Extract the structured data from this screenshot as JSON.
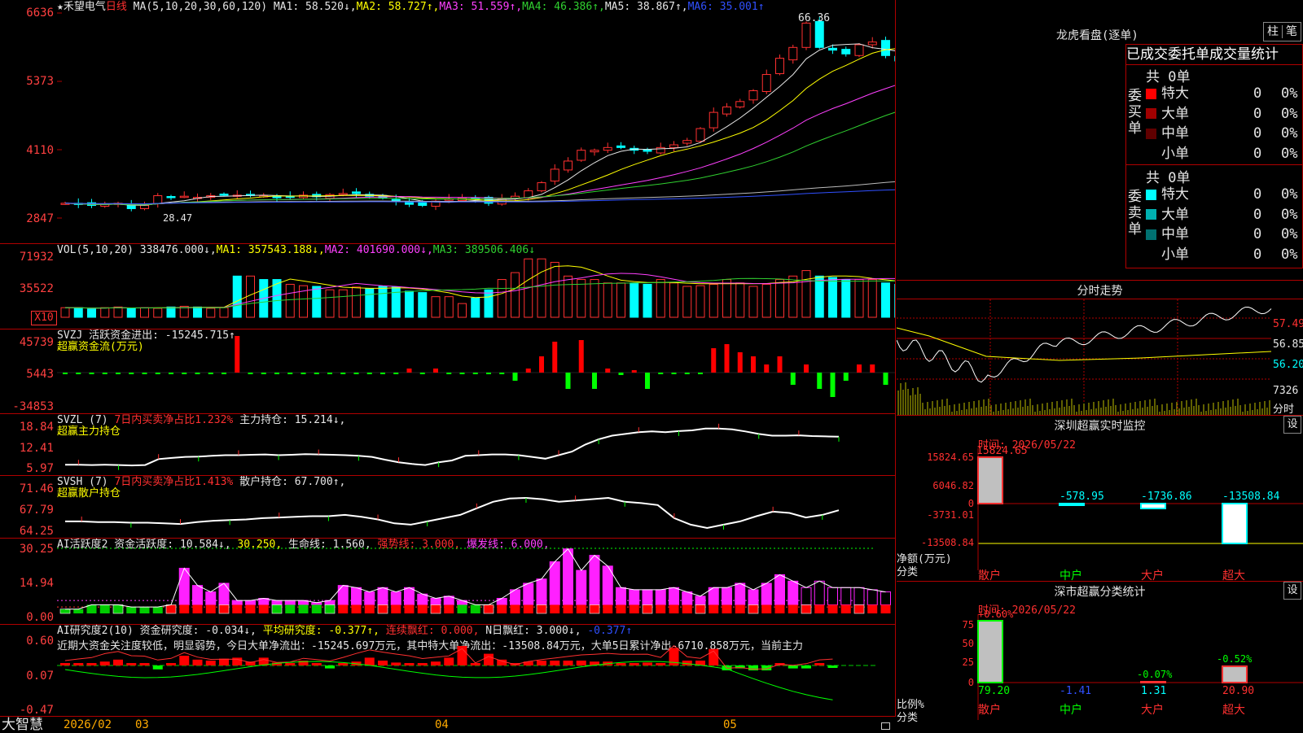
{
  "stock": {
    "name": "★禾望电气",
    "period": "日线",
    "ma_line": [
      {
        "t": "MA(5,10,20,30,60,120) ",
        "c": "w"
      },
      {
        "t": "MA1: 58.520↓,",
        "c": "w"
      },
      {
        "t": "MA2: 58.727↑,",
        "c": "y"
      },
      {
        "t": "MA3: 51.559↑,",
        "c": "m"
      },
      {
        "t": "MA4: 46.386↑,",
        "c": "g"
      },
      {
        "t": "MA5: 38.867↑,",
        "c": "w"
      },
      {
        "t": "MA6: 35.001↑",
        "c": "b"
      }
    ]
  },
  "bottom_bar": {
    "brand": "大智慧",
    "dates": [
      "2026/02",
      "03",
      "04",
      "05"
    ]
  },
  "panels": {
    "price": {
      "y_labels": [
        "6636",
        "5373",
        "4110",
        "2847"
      ],
      "high_label": "66.36",
      "low_label": "28.47"
    },
    "vol": {
      "y_labels": [
        "71932",
        "35522",
        "X10"
      ],
      "header": [
        {
          "t": "VOL(5,10,20) ",
          "c": "w"
        },
        {
          "t": "338476.000↓,",
          "c": "w"
        },
        {
          "t": "MA1: 357543.188↓,",
          "c": "y"
        },
        {
          "t": "MA2: 401690.000↓,",
          "c": "m"
        },
        {
          "t": "MA3: 389506.406↓",
          "c": "g"
        }
      ]
    },
    "svzj": {
      "y_labels": [
        "45739",
        "5443",
        "-34853"
      ],
      "header": [
        {
          "t": "SVZJ  活跃资金进出: -15245.715↑,",
          "c": "w"
        }
      ],
      "subtitle": "超赢资金流(万元)"
    },
    "svzl": {
      "y_labels": [
        "18.84",
        "12.41",
        "5.97"
      ],
      "header": [
        {
          "t": "SVZL (7) ",
          "c": "w"
        },
        {
          "t": "7日内买卖净占比1.232% ",
          "c": "r"
        },
        {
          "t": "主力持仓: 15.214↓,",
          "c": "w"
        }
      ],
      "subtitle": "超赢主力持仓"
    },
    "svsh": {
      "y_labels": [
        "71.46",
        "67.79",
        "64.25"
      ],
      "header": [
        {
          "t": "SVSH (7) ",
          "c": "w"
        },
        {
          "t": "7日内买卖净占比1.413% ",
          "c": "r"
        },
        {
          "t": "散户持仓: 67.700↑,",
          "c": "w"
        }
      ],
      "subtitle": "超赢散户持仓"
    },
    "ai1": {
      "y_labels": [
        "30.25",
        "14.94",
        "0.00"
      ],
      "header": [
        {
          "t": "AI活跃度2 资金活跃度: 10.584↓, ",
          "c": "w"
        },
        {
          "t": "30.250, ",
          "c": "y"
        },
        {
          "t": "生命线: 1.560, ",
          "c": "w"
        },
        {
          "t": "强势线: 3.000, ",
          "c": "r"
        },
        {
          "t": "爆发线: 6.000,",
          "c": "m"
        }
      ]
    },
    "ai2": {
      "y_labels": [
        "0.60",
        "0.07",
        "-0.47"
      ],
      "header": [
        {
          "t": "AI研究度2(10) 资金研究度: -0.034↓, ",
          "c": "w"
        },
        {
          "t": "平均研究度: -0.377↑, ",
          "c": "y"
        },
        {
          "t": "连续飘红: 0.000, ",
          "c": "r"
        },
        {
          "t": "N日飘红: 3.000↓, ",
          "c": "w"
        },
        {
          "t": "-0.377↑",
          "c": "b"
        }
      ],
      "text": "近期大资金关注度较低，明显弱势，今日大单净流出：-15245.697万元，其中特大单净流出：-13508.84万元，大单5日累计净出-6710.858万元，当前主力"
    }
  },
  "right": {
    "lhb": {
      "title": "龙虎看盘(逐单)",
      "buttons": [
        "柱",
        "笔"
      ],
      "tabs": [
        "已成交委托",
        "单成交量统计"
      ],
      "buy": {
        "label": "委买单",
        "total": "共 0单",
        "rows": [
          {
            "name": "特大",
            "val": "0",
            "pct": "0%",
            "color": "#ff0000"
          },
          {
            "name": "大单",
            "val": "0",
            "pct": "0%",
            "color": "#a00000"
          },
          {
            "name": "中单",
            "val": "0",
            "pct": "0%",
            "color": "#600000"
          },
          {
            "name": "小单",
            "val": "0",
            "pct": "0%",
            "color": "#000000"
          }
        ]
      },
      "sell": {
        "label": "委卖单",
        "total": "共 0单",
        "rows": [
          {
            "name": "特大",
            "val": "0",
            "pct": "0%",
            "color": "#00ffff"
          },
          {
            "name": "大单",
            "val": "0",
            "pct": "0%",
            "color": "#00b0b0"
          },
          {
            "name": "中单",
            "val": "0",
            "pct": "0%",
            "color": "#007070"
          },
          {
            "name": "小单",
            "val": "0",
            "pct": "0%",
            "color": "#000000"
          }
        ]
      }
    },
    "intraday": {
      "title": "分时走势",
      "labels": [
        "57.49",
        "56.85",
        "56.20",
        "7326",
        "分时"
      ]
    },
    "monitor": {
      "title": "深圳超赢实时监控",
      "set": "设",
      "time": "时间: 2026/05/22",
      "y_labels": [
        "15824.65",
        "6046.82",
        "0",
        "-3731.01",
        "-13508.84"
      ],
      "unit_label": "净额(万元)",
      "cat_label": "分类",
      "categories": [
        "散户",
        "中户",
        "大户",
        "超大"
      ],
      "values": [
        "15824.65",
        "-578.95",
        "-1736.86",
        "-13508.84"
      ]
    },
    "stats": {
      "title": "深市超赢分类统计",
      "set": "设",
      "time": "时间: 2026/05/22",
      "y_labels": [
        "75",
        "50",
        "25",
        "0"
      ],
      "unit_label": "比例%",
      "cat_label": "分类",
      "categories": [
        "散户",
        "中户",
        "大户",
        "超大"
      ],
      "values": [
        "79.20",
        "-1.41",
        "1.31",
        "20.90"
      ],
      "pct_labels": [
        "+0.60%",
        "-0.07%",
        "-0.52%"
      ]
    }
  },
  "chart_data": [
    {
      "type": "candlestick",
      "title": "禾望电气 日线",
      "ylim": [
        28.47,
        66.36
      ],
      "y_ticks": [
        66.36,
        53.73,
        41.1,
        28.47
      ],
      "x_months": [
        "2026/02",
        "03",
        "04",
        "05"
      ],
      "close": [
        31.2,
        31.0,
        30.8,
        31.0,
        31.2,
        30.2,
        30.8,
        32.6,
        32.3,
        32.5,
        32.3,
        32.6,
        32.8,
        32.7,
        32.8,
        32.6,
        32.2,
        32.4,
        32.7,
        32.4,
        32.8,
        33.0,
        33.0,
        32.5,
        32.2,
        31.5,
        31.0,
        30.8,
        31.6,
        32.0,
        32.2,
        32.0,
        31.2,
        32.0,
        32.5,
        33.5,
        35.0,
        37.5,
        39.0,
        41.0,
        41.0,
        41.5,
        41.5,
        41.0,
        40.8,
        41.5,
        42.0,
        42.8,
        45.0,
        48.0,
        49.0,
        50.0,
        52.0,
        55.0,
        58.0,
        60.0,
        64.5,
        60.0,
        59.5,
        58.8,
        60.5,
        61.0,
        58.5,
        57.5
      ],
      "ma_series": [
        "MA1",
        "MA2",
        "MA3",
        "MA4",
        "MA5",
        "MA6"
      ]
    },
    {
      "type": "bar",
      "title": "VOL(5,10,20)",
      "ylim": [
        0,
        719320
      ],
      "y_ticks": [
        719320,
        355220
      ],
      "unit": "X10",
      "values": [
        14,
        14,
        12,
        14,
        15,
        13,
        14,
        13,
        15,
        16,
        15,
        13,
        14,
        60,
        60,
        55,
        55,
        48,
        46,
        45,
        40,
        40,
        44,
        42,
        45,
        44,
        38,
        36,
        30,
        30,
        20,
        28,
        40,
        55,
        65,
        85,
        85,
        80,
        60,
        55,
        55,
        50,
        50,
        50,
        48,
        55,
        50,
        45,
        46,
        48,
        55,
        50,
        45,
        48,
        55,
        60,
        68,
        60,
        58,
        55,
        55,
        55,
        50,
        48
      ]
    },
    {
      "type": "bar",
      "title": "SVZJ 活跃资金进出 (万元)",
      "ylim": [
        -34853,
        45739
      ],
      "y_ticks": [
        45739,
        5443,
        -34853
      ],
      "values": [
        0,
        0,
        0,
        0,
        0,
        -1,
        -1,
        -1,
        -1,
        -1,
        0,
        0,
        0,
        45,
        0,
        0,
        0,
        0,
        0,
        0,
        0,
        0,
        0,
        0,
        0,
        0,
        5,
        0,
        5,
        0,
        0,
        0,
        0,
        0,
        -10,
        5,
        20,
        38,
        -20,
        40,
        -20,
        5,
        -3,
        3,
        -20,
        0,
        0,
        0,
        0,
        30,
        35,
        25,
        20,
        10,
        20,
        -15,
        10,
        -20,
        -30,
        -10,
        10,
        10,
        -15,
        -15
      ],
      "latest": -15245.715
    },
    {
      "type": "line",
      "title": "SVZL 主力持仓",
      "ylim": [
        5.97,
        18.84
      ],
      "y_ticks": [
        18.84,
        12.41,
        5.97
      ],
      "values": [
        7.3,
        7.3,
        7.2,
        7.3,
        7.2,
        7.1,
        7.2,
        8.9,
        9.2,
        9.5,
        9.6,
        9.8,
        10.0,
        10.0,
        10.1,
        10.2,
        10.0,
        10.1,
        10.3,
        10.2,
        10.1,
        10.0,
        9.8,
        9.5,
        8.7,
        8.0,
        7.5,
        7.2,
        8.0,
        8.5,
        9.8,
        10.0,
        10.2,
        10.2,
        10.0,
        9.5,
        9.0,
        10.0,
        11.0,
        13.0,
        14.5,
        15.5,
        16.0,
        16.5,
        16.7,
        16.5,
        16.8,
        17.0,
        17.5,
        17.5,
        17.3,
        16.7,
        16.0,
        15.5,
        15.5,
        15.6,
        15.4,
        15.3,
        15.2
      ],
      "latest": 15.214
    },
    {
      "type": "line",
      "title": "SVSH 散户持仓",
      "ylim": [
        64.25,
        71.46
      ],
      "y_ticks": [
        71.46,
        67.79,
        64.25
      ],
      "values": [
        66.0,
        66.0,
        65.9,
        65.9,
        65.8,
        65.8,
        65.7,
        65.6,
        65.9,
        66.1,
        66.2,
        66.3,
        66.5,
        66.6,
        66.7,
        66.8,
        66.8,
        67.0,
        66.7,
        66.3,
        65.7,
        65.5,
        66.0,
        66.5,
        67.0,
        68.0,
        69.0,
        69.5,
        69.6,
        69.4,
        69.0,
        69.2,
        69.4,
        69.6,
        69.0,
        68.8,
        68.5,
        66.5,
        65.5,
        65.0,
        65.5,
        66.0,
        66.8,
        67.5,
        67.3,
        66.6,
        67.0,
        67.7
      ],
      "latest": 67.7
    },
    {
      "type": "bar",
      "title": "AI活跃度2 资金活跃度",
      "ylim": [
        0,
        30.25
      ],
      "y_ticks": [
        30.25,
        14.94,
        0
      ],
      "values": [
        2,
        2,
        4,
        4,
        4,
        3,
        3,
        3,
        4,
        21,
        13,
        10,
        14,
        6,
        6,
        7,
        6,
        6,
        6,
        5,
        6,
        13,
        12,
        10,
        12,
        10,
        12,
        9,
        7,
        8,
        6,
        4,
        4,
        7,
        11,
        14,
        16,
        24,
        30,
        20,
        27,
        22,
        12,
        11,
        11,
        11,
        12,
        10,
        8,
        12,
        12,
        14,
        11,
        14,
        18,
        15,
        12,
        15,
        12,
        12,
        12,
        11,
        10
      ],
      "life_line": 1.56,
      "strong_line": 3.0,
      "burst_line": 6.0,
      "latest": 10.584
    },
    {
      "type": "bar",
      "title": "AI研究度2(10) 资金研究度",
      "ylim": [
        -0.47,
        0.6
      ],
      "y_ticks": [
        0.6,
        0.07,
        -0.47
      ],
      "values": [
        0,
        0,
        0,
        0.04,
        0.06,
        0,
        0,
        -0.04,
        0,
        0.1,
        0.06,
        0.05,
        0.07,
        0.08,
        0.04,
        0.08,
        0.03,
        0.02,
        0.05,
        0.01,
        -0.03,
        0,
        0.04,
        0.08,
        0.05,
        0.03,
        0.02,
        0,
        0.04,
        0.08,
        0.2,
        0.02,
        0.12,
        0.06,
        0.01,
        0.04,
        0.05,
        0.05,
        0.05,
        0.05,
        0.04,
        0.04,
        0.02,
        0.02,
        0.03,
        0,
        0.18,
        0.05,
        0.05,
        0.17,
        -0.05,
        -0.03,
        -0.05,
        -0.05,
        0,
        -0.03,
        -0.03,
        0,
        -0.01
      ],
      "mean_line": -0.377,
      "latest": -0.034
    },
    {
      "type": "bar",
      "title": "深圳超赢实时监控",
      "categories": [
        "散户",
        "中户",
        "大户",
        "超大"
      ],
      "values": [
        15824.65,
        -578.95,
        -1736.86,
        -13508.84
      ],
      "ylim": [
        -13508.84,
        15824.65
      ],
      "ylabel": "净额(万元)",
      "xlabel": "分类"
    },
    {
      "type": "bar",
      "title": "深市超赢分类统计",
      "categories": [
        "散户",
        "中户",
        "大户",
        "超大"
      ],
      "values": [
        79.2,
        -1.41,
        1.31,
        20.9
      ],
      "ylim": [
        0,
        79.2
      ],
      "ylabel": "比例%",
      "xlabel": "分类"
    }
  ]
}
